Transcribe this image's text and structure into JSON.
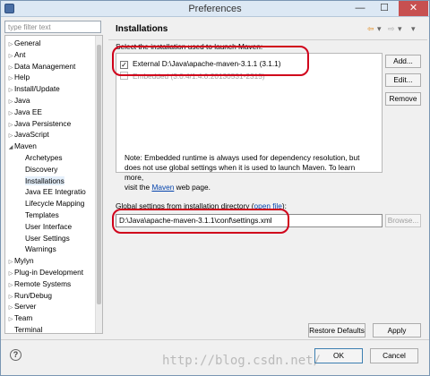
{
  "window": {
    "title": "Preferences",
    "minimize": "—",
    "maximize": "☐",
    "close": "✕"
  },
  "filter": {
    "placeholder": "type filter text"
  },
  "tree": [
    {
      "label": "General",
      "arrow": "▷",
      "level": 0
    },
    {
      "label": "Ant",
      "arrow": "▷",
      "level": 0
    },
    {
      "label": "Data Management",
      "arrow": "▷",
      "level": 0
    },
    {
      "label": "Help",
      "arrow": "▷",
      "level": 0
    },
    {
      "label": "Install/Update",
      "arrow": "▷",
      "level": 0
    },
    {
      "label": "Java",
      "arrow": "▷",
      "level": 0
    },
    {
      "label": "Java EE",
      "arrow": "▷",
      "level": 0
    },
    {
      "label": "Java Persistence",
      "arrow": "▷",
      "level": 0
    },
    {
      "label": "JavaScript",
      "arrow": "▷",
      "level": 0
    },
    {
      "label": "Maven",
      "arrow": "◢",
      "level": 0
    },
    {
      "label": "Archetypes",
      "arrow": "",
      "level": 1
    },
    {
      "label": "Discovery",
      "arrow": "",
      "level": 1
    },
    {
      "label": "Installations",
      "arrow": "",
      "level": 1
    },
    {
      "label": "Java EE Integratio",
      "arrow": "",
      "level": 1
    },
    {
      "label": "Lifecycle Mapping",
      "arrow": "",
      "level": 1
    },
    {
      "label": "Templates",
      "arrow": "",
      "level": 1
    },
    {
      "label": "User Interface",
      "arrow": "",
      "level": 1
    },
    {
      "label": "User Settings",
      "arrow": "",
      "level": 1
    },
    {
      "label": "Warnings",
      "arrow": "",
      "level": 1
    },
    {
      "label": "Mylyn",
      "arrow": "▷",
      "level": 0
    },
    {
      "label": "Plug-in Development",
      "arrow": "▷",
      "level": 0
    },
    {
      "label": "Remote Systems",
      "arrow": "▷",
      "level": 0
    },
    {
      "label": "Run/Debug",
      "arrow": "▷",
      "level": 0
    },
    {
      "label": "Server",
      "arrow": "▷",
      "level": 0
    },
    {
      "label": "Team",
      "arrow": "▷",
      "level": 0
    },
    {
      "label": "Terminal",
      "arrow": "",
      "level": 0
    }
  ],
  "page": {
    "title": "Installations",
    "nav_back": "⇦",
    "nav_dropdown": "▾",
    "nav_forward": "⇨",
    "view_menu": "▾",
    "installations_label": "Select the installation used to launch Maven:",
    "installations": [
      {
        "label": "External D:\\Java\\apache-maven-3.1.1 (3.1.1)",
        "checked": true,
        "check_mark": "✓",
        "enabled": true
      },
      {
        "label": "Embedded (3.0.4/1.4.0.20130531-2315)",
        "checked": false,
        "check_mark": "",
        "enabled": false
      }
    ],
    "add_button": "Add...",
    "edit_button": "Edit...",
    "remove_button": "Remove",
    "note_line1": "Note: Embedded runtime is always used for dependency resolution, but",
    "note_line2": "does not use global settings when it is used to launch Maven. To learn more,",
    "note_line3_pre": "visit the ",
    "note_link": "Maven",
    "note_line3_post": " web page.",
    "global_label_pre": "Global settings from installation directory (",
    "global_label_link": "open file",
    "global_label_post": "):",
    "global_path": "D:\\Java\\apache-maven-3.1.1\\conf\\settings.xml",
    "browse_button": "Browse...",
    "restore_button": "Restore Defaults",
    "apply_button": "Apply"
  },
  "footer": {
    "help": "?",
    "ok_button": "OK",
    "cancel_button": "Cancel"
  },
  "watermark": "http://blog.csdn.net/",
  "colors": {
    "annotation": "#d0021b",
    "accent": "#3c7fb1"
  }
}
